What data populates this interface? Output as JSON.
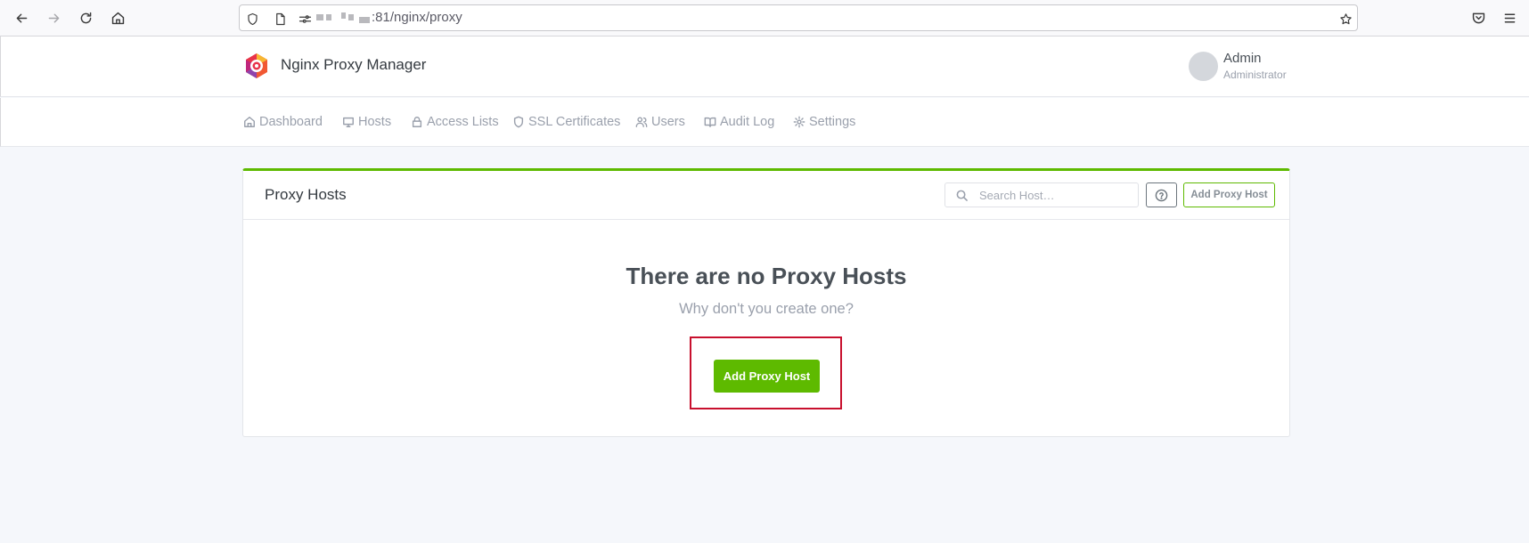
{
  "browser": {
    "url_suffix": ":81/nginx/proxy"
  },
  "app": {
    "brand": "Nginx Proxy Manager",
    "user_name": "Admin",
    "user_role": "Administrator"
  },
  "nav": {
    "tabs": [
      {
        "label": "Dashboard",
        "icon": "home-icon"
      },
      {
        "label": "Hosts",
        "icon": "monitor-icon"
      },
      {
        "label": "Access Lists",
        "icon": "lock-icon"
      },
      {
        "label": "SSL Certificates",
        "icon": "shield-icon"
      },
      {
        "label": "Users",
        "icon": "users-icon"
      },
      {
        "label": "Audit Log",
        "icon": "book-icon"
      },
      {
        "label": "Settings",
        "icon": "gear-icon"
      }
    ]
  },
  "card": {
    "title": "Proxy Hosts",
    "search_placeholder": "Search Host…",
    "header_add_label": "Add Proxy Host",
    "empty_title": "There are no Proxy Hosts",
    "empty_subtitle": "Why don't you create one?",
    "primary_add_label": "Add Proxy Host"
  },
  "colors": {
    "accent_green": "#5eba00",
    "highlight_red": "#c8102e"
  }
}
